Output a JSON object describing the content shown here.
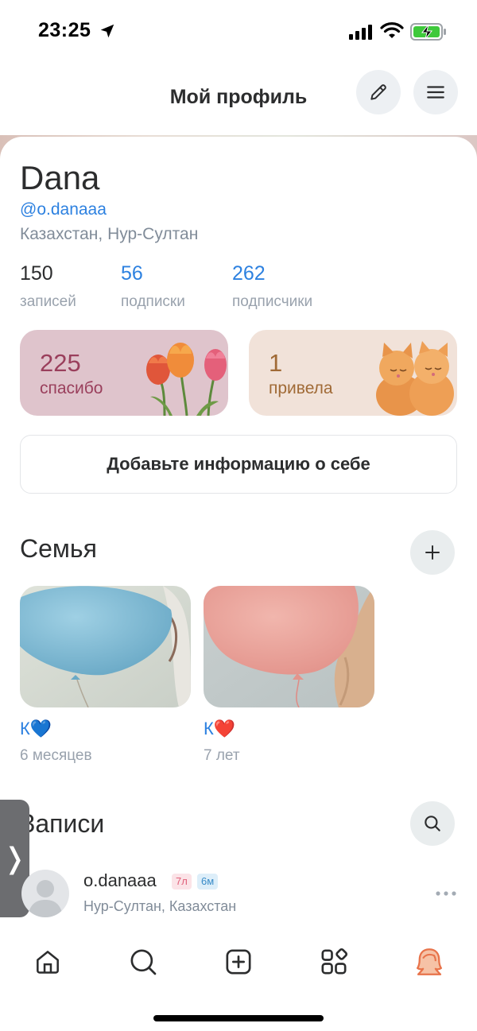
{
  "status_bar": {
    "time": "23:25",
    "icons": [
      "location-arrow-icon",
      "signal-icon",
      "wifi-icon",
      "battery-charging-icon"
    ]
  },
  "header": {
    "title": "Мой профиль",
    "edit_icon": "pencil-icon",
    "menu_icon": "hamburger-menu-icon"
  },
  "profile": {
    "name": "Dana",
    "handle": "@o.danaaa",
    "location": "Казахстан, Нур-Султан"
  },
  "stats": [
    {
      "value": "150",
      "label": "записей"
    },
    {
      "value": "56",
      "label": "подписки"
    },
    {
      "value": "262",
      "label": "подписчики"
    }
  ],
  "badges": {
    "thanks": {
      "value": "225",
      "label": "спасибо",
      "art": "tulips-image"
    },
    "brought": {
      "value": "1",
      "label": "привела",
      "art": "kittens-image"
    }
  },
  "about_button": "Добавьте информацию о себе",
  "family": {
    "title": "Семья",
    "add_icon": "plus-icon",
    "members": [
      {
        "name": "К💙",
        "age": "6 месяцев",
        "photo": "blue-balloon-photo"
      },
      {
        "name": "К❤️",
        "age": "7 лет",
        "photo": "pink-balloon-photo"
      }
    ]
  },
  "posts": {
    "title": "Записи",
    "search_icon": "search-icon",
    "first_post": {
      "author": "o.danaaa",
      "chips": [
        "7л",
        "6м"
      ],
      "location": "Нур-Султан, Казахстан"
    }
  },
  "side_tab": {
    "glyph": "❭"
  },
  "tab_bar": {
    "items": [
      "home-icon",
      "search-icon",
      "add-post-icon",
      "services-icon",
      "profile-avatar-icon"
    ],
    "active": "profile-avatar-icon"
  },
  "colors": {
    "accent_blue": "#2d81e0",
    "thanks_bg": "#dfc4cc",
    "brought_bg": "#f1e2d9",
    "active_tab": "#e8734a"
  }
}
